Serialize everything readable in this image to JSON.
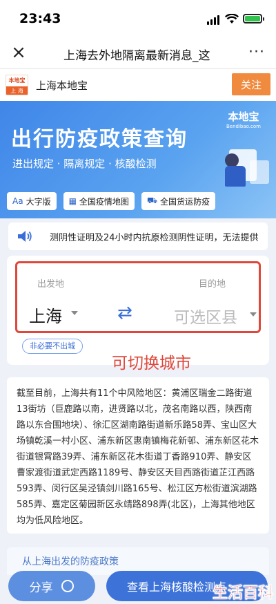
{
  "status_bar": {
    "time": "23:43"
  },
  "nav": {
    "title": "上海去外地隔离最新消息_这",
    "close_icon": "close-icon",
    "more_label": "···"
  },
  "account": {
    "logo_top": "本地宝",
    "logo_bottom": "上 海",
    "name": "上海本地宝",
    "follow_label": "关注"
  },
  "banner": {
    "brand_cn": "本地宝",
    "brand_en": "Bendibao.com",
    "heading": "出行防疫政策查询",
    "subheading": "进出规定 · 隔离规定 · 核酸检测",
    "chips": [
      {
        "icon": "font-size-icon",
        "glyph": "Aa",
        "label": "大字版"
      },
      {
        "icon": "map-icon",
        "glyph": "▦",
        "label": "全国疫情地图"
      },
      {
        "icon": "truck-icon",
        "glyph": "⛟",
        "label": "全国货运防疫"
      }
    ]
  },
  "notice": {
    "text": "测阴性证明及24小时内抗原检测阴性证明，无法提供"
  },
  "query": {
    "from_label": "出发地",
    "to_label": "目的地",
    "from_value": "上海",
    "to_placeholder": "可选区县",
    "swap_glyph": "⇄",
    "tag": "非必要不出城",
    "annotation": "可切换城市"
  },
  "info": {
    "text": "截至目前，上海共有11个中风险地区：黄浦区瑞金二路街道13街坊（巨鹿路以南，进贤路以北，茂名南路以西，陕西南路以东合围地块）、徐汇区湖南路街道新乐路58弄、宝山区大场镇乾溪一村小区、浦东新区惠南镇梅花新邨、浦东新区花木街道银霄路39弄、浦东新区花木街道丁香路910弄、静安区曹家渡街道武定西路1189号、静安区天目西路街道芷江西路593弄、闵行区吴泾镇剑川路165号、松江区方松街道滨湖路585弄、嘉定区菊园新区永靖路898弄(北区)，上海其他地区均为低风险地区。"
  },
  "policy": {
    "title": "从上海出发的防疫政策"
  },
  "footer": {
    "share_label": "分享",
    "check_label": "查看上海核酸检测点",
    "watermark": "生活百科"
  }
}
